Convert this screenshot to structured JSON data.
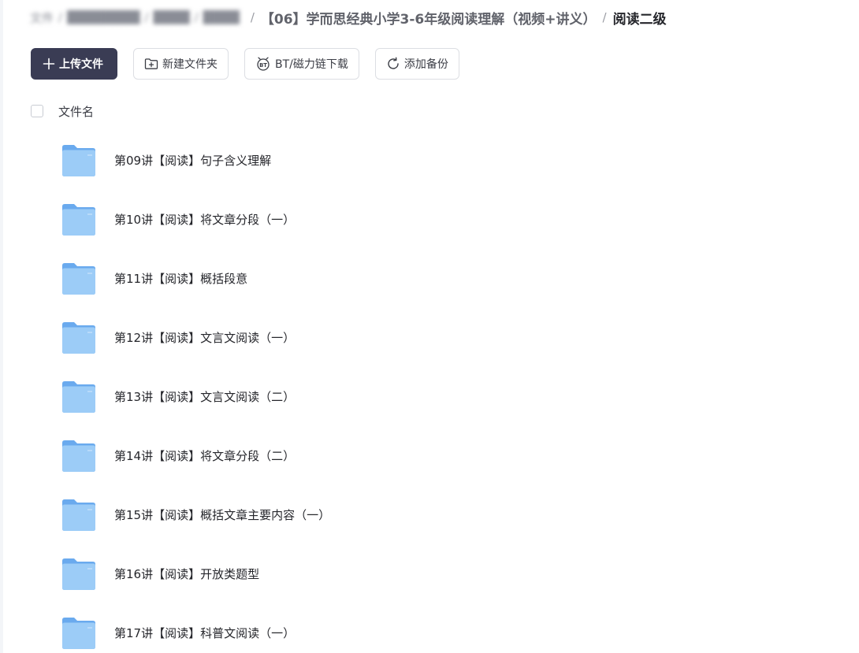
{
  "breadcrumb": {
    "hidden_parts": [
      "文件",
      "████████",
      "████",
      "████"
    ],
    "parent": "【06】学而思经典小学3-6年级阅读理解（视频+讲义）",
    "current": "阅读二级"
  },
  "toolbar": {
    "upload_label": "上传文件",
    "new_folder_label": "新建文件夹",
    "bt_label": "BT/磁力链下载",
    "backup_label": "添加备份"
  },
  "list_header": {
    "name_label": "文件名"
  },
  "files": [
    {
      "name": "第09讲【阅读】句子含义理解"
    },
    {
      "name": "第10讲【阅读】将文章分段（一）"
    },
    {
      "name": "第11讲【阅读】概括段意"
    },
    {
      "name": "第12讲【阅读】文言文阅读（一）"
    },
    {
      "name": "第13讲【阅读】文言文阅读（二）"
    },
    {
      "name": "第14讲【阅读】将文章分段（二）"
    },
    {
      "name": "第15讲【阅读】概括文章主要内容（一）"
    },
    {
      "name": "第16讲【阅读】开放类题型"
    },
    {
      "name": "第17讲【阅读】科普文阅读（一）"
    }
  ],
  "colors": {
    "primary_button": "#3a3c54",
    "folder_blue": "#7fb9f0"
  },
  "icons": {
    "upload": "plus-icon",
    "new_folder": "folder-plus-icon",
    "bt": "bt-icon",
    "backup": "refresh-icon",
    "file": "folder-icon"
  }
}
